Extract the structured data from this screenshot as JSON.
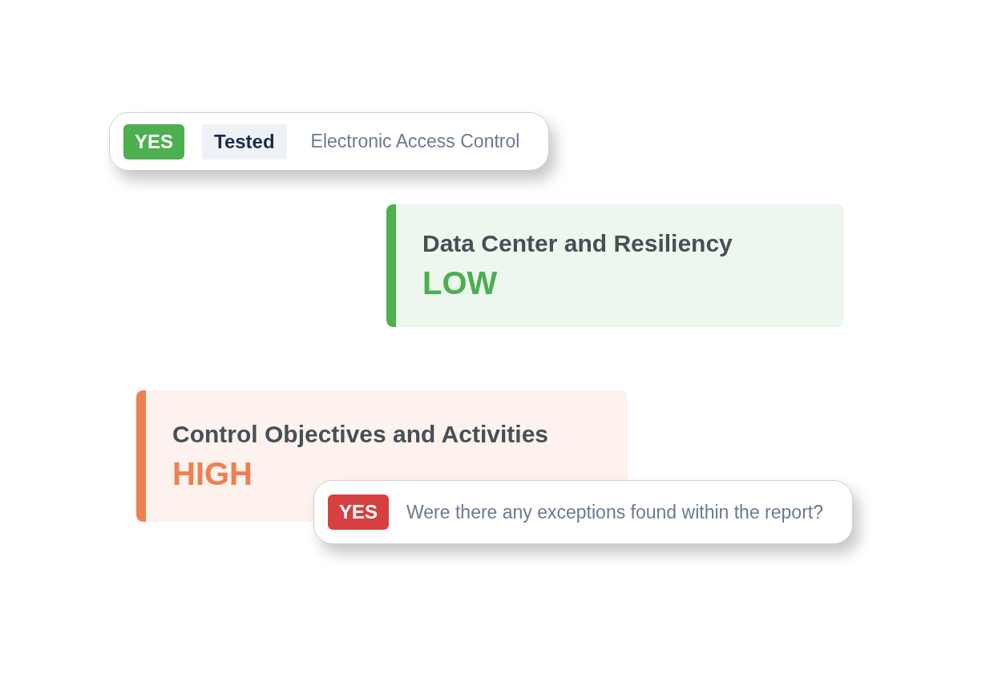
{
  "items": [
    {
      "kind": "pill",
      "answer": "YES",
      "color": "#4caf50",
      "tag": "Tested",
      "text": "Electronic Access Control"
    },
    {
      "kind": "risk",
      "title": "Data Center and Resiliency",
      "level_label": "LOW",
      "color": "#4caf50"
    },
    {
      "kind": "risk",
      "title": "Control Objectives and Activities",
      "level_label": "HIGH",
      "color": "#ef7f52"
    },
    {
      "kind": "pill",
      "answer": "YES",
      "color": "#d64040",
      "text": "Were there any exceptions found within the report?"
    }
  ]
}
